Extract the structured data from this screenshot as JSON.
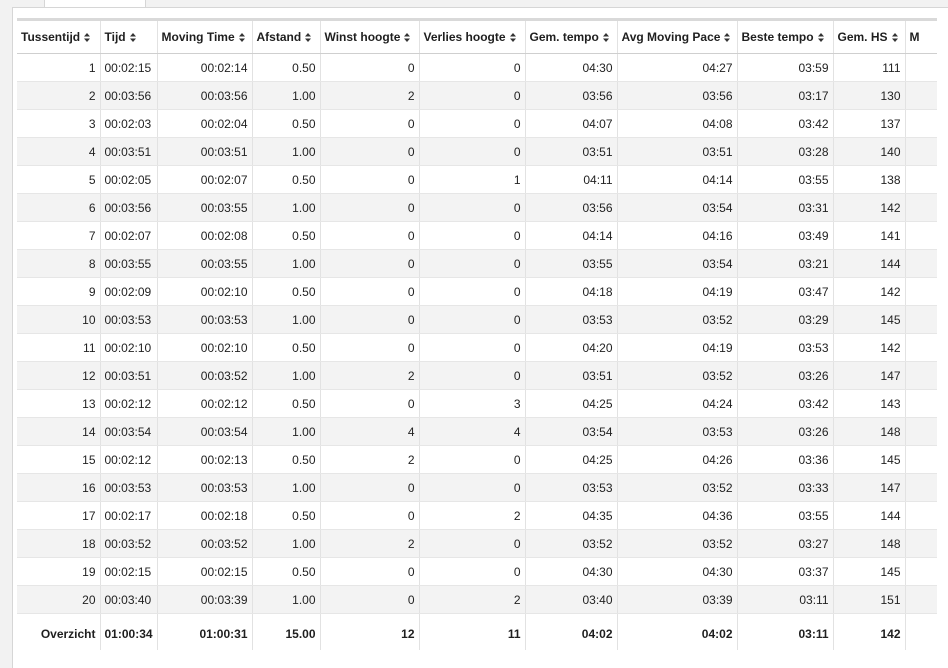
{
  "table": {
    "headers": [
      "Tussentijd",
      "Tijd",
      "Moving Time",
      "Afstand",
      "Winst hoogte",
      "Verlies hoogte",
      "Gem. tempo",
      "Avg Moving Pace",
      "Beste tempo",
      "Gem. HS",
      "M"
    ],
    "rows": [
      [
        "1",
        "00:02:15",
        "00:02:14",
        "0.50",
        "0",
        "0",
        "04:30",
        "04:27",
        "03:59",
        "111",
        ""
      ],
      [
        "2",
        "00:03:56",
        "00:03:56",
        "1.00",
        "2",
        "0",
        "03:56",
        "03:56",
        "03:17",
        "130",
        ""
      ],
      [
        "3",
        "00:02:03",
        "00:02:04",
        "0.50",
        "0",
        "0",
        "04:07",
        "04:08",
        "03:42",
        "137",
        ""
      ],
      [
        "4",
        "00:03:51",
        "00:03:51",
        "1.00",
        "0",
        "0",
        "03:51",
        "03:51",
        "03:28",
        "140",
        ""
      ],
      [
        "5",
        "00:02:05",
        "00:02:07",
        "0.50",
        "0",
        "1",
        "04:11",
        "04:14",
        "03:55",
        "138",
        ""
      ],
      [
        "6",
        "00:03:56",
        "00:03:55",
        "1.00",
        "0",
        "0",
        "03:56",
        "03:54",
        "03:31",
        "142",
        ""
      ],
      [
        "7",
        "00:02:07",
        "00:02:08",
        "0.50",
        "0",
        "0",
        "04:14",
        "04:16",
        "03:49",
        "141",
        ""
      ],
      [
        "8",
        "00:03:55",
        "00:03:55",
        "1.00",
        "0",
        "0",
        "03:55",
        "03:54",
        "03:21",
        "144",
        ""
      ],
      [
        "9",
        "00:02:09",
        "00:02:10",
        "0.50",
        "0",
        "0",
        "04:18",
        "04:19",
        "03:47",
        "142",
        ""
      ],
      [
        "10",
        "00:03:53",
        "00:03:53",
        "1.00",
        "0",
        "0",
        "03:53",
        "03:52",
        "03:29",
        "145",
        ""
      ],
      [
        "11",
        "00:02:10",
        "00:02:10",
        "0.50",
        "0",
        "0",
        "04:20",
        "04:19",
        "03:53",
        "142",
        ""
      ],
      [
        "12",
        "00:03:51",
        "00:03:52",
        "1.00",
        "2",
        "0",
        "03:51",
        "03:52",
        "03:26",
        "147",
        ""
      ],
      [
        "13",
        "00:02:12",
        "00:02:12",
        "0.50",
        "0",
        "3",
        "04:25",
        "04:24",
        "03:42",
        "143",
        ""
      ],
      [
        "14",
        "00:03:54",
        "00:03:54",
        "1.00",
        "4",
        "4",
        "03:54",
        "03:53",
        "03:26",
        "148",
        ""
      ],
      [
        "15",
        "00:02:12",
        "00:02:13",
        "0.50",
        "2",
        "0",
        "04:25",
        "04:26",
        "03:36",
        "145",
        ""
      ],
      [
        "16",
        "00:03:53",
        "00:03:53",
        "1.00",
        "0",
        "0",
        "03:53",
        "03:52",
        "03:33",
        "147",
        ""
      ],
      [
        "17",
        "00:02:17",
        "00:02:18",
        "0.50",
        "0",
        "2",
        "04:35",
        "04:36",
        "03:55",
        "144",
        ""
      ],
      [
        "18",
        "00:03:52",
        "00:03:52",
        "1.00",
        "2",
        "0",
        "03:52",
        "03:52",
        "03:27",
        "148",
        ""
      ],
      [
        "19",
        "00:02:15",
        "00:02:15",
        "0.50",
        "0",
        "0",
        "04:30",
        "04:30",
        "03:37",
        "145",
        ""
      ],
      [
        "20",
        "00:03:40",
        "00:03:39",
        "1.00",
        "0",
        "2",
        "03:40",
        "03:39",
        "03:11",
        "151",
        ""
      ]
    ],
    "summary": [
      "Overzicht",
      "01:00:34",
      "01:00:31",
      "15.00",
      "12",
      "11",
      "04:02",
      "04:02",
      "03:11",
      "142",
      ""
    ],
    "sort_icon": "sort-arrows-icon"
  },
  "colors": {
    "row_alt": "#f3f3f3",
    "border": "#e2e2e2",
    "header_top_border": "#d9d9d9",
    "page_bg": "#f2f2f2"
  }
}
